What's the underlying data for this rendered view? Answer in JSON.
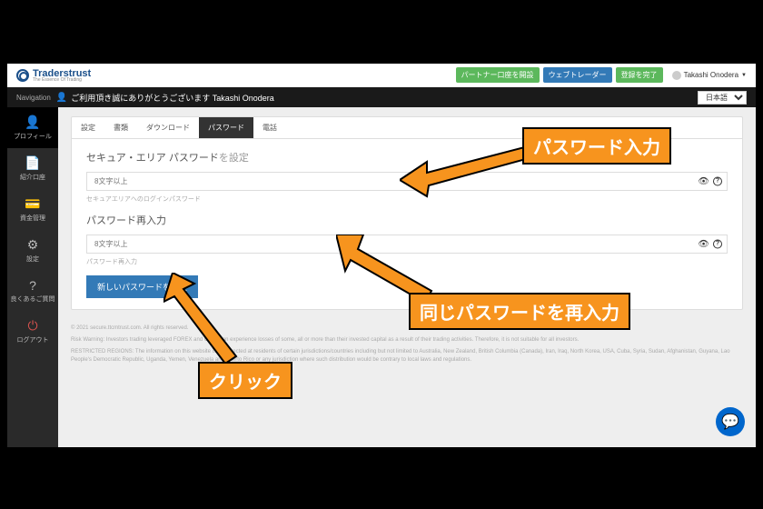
{
  "logo": {
    "name": "Traderstrust",
    "sub": "The Essence Of Trading"
  },
  "topButtons": {
    "partner": "パートナー口座を開設",
    "webtrader": "ウェブトレーダー",
    "register": "登録を完了"
  },
  "user": {
    "name": "Takashi Onodera"
  },
  "blackbar": {
    "nav": "Navigation",
    "greeting": "ご利用頂き誠にありがとうございます Takashi Onodera",
    "lang": "日本語"
  },
  "sidebar": {
    "items": [
      {
        "label": "プロフィール"
      },
      {
        "label": "紹介口座"
      },
      {
        "label": "資金管理"
      },
      {
        "label": "設定"
      },
      {
        "label": "良くあるご質問"
      },
      {
        "label": "ログアウト"
      }
    ]
  },
  "tabs": {
    "t0": "設定",
    "t1": "書類",
    "t2": "ダウンロード",
    "t3": "パスワード",
    "t4": "電話"
  },
  "form": {
    "title1a": "セキュア・エリア パスワード",
    "title1b": "を設定",
    "placeholder": "8文字以上",
    "hint1": "セキュアエリアへのログインパスワード",
    "title2": "パスワード再入力",
    "hint2": "パスワード再入力",
    "submit": "新しいパスワードを設定"
  },
  "footer": {
    "copy": "© 2021 secure.ttcmtrust.com. All rights reserved.",
    "risk": "Risk Warning: Investors trading leveraged FOREX and CFDs can experience losses of some, all or more than their invested capital as a result of their trading activities. Therefore, it is not suitable for all investors.",
    "restricted": "RESTRICTED REGIONS: The information on this website is not directed at residents of certain jurisdictions/countries including but not limited to Australia, New Zealand, British Columbia (Canada), Iran, Iraq, North Korea, USA, Cuba, Syria, Sudan, Afghanistan, Guyana, Lao People's Democratic Republic, Uganda, Yemen, Venezuela and Puerto Rico or any jurisdiction where such distribution would be contrary to local laws and regulations."
  },
  "annotations": {
    "a1": "パスワード入力",
    "a2": "同じパスワードを再入力",
    "a3": "クリック"
  }
}
